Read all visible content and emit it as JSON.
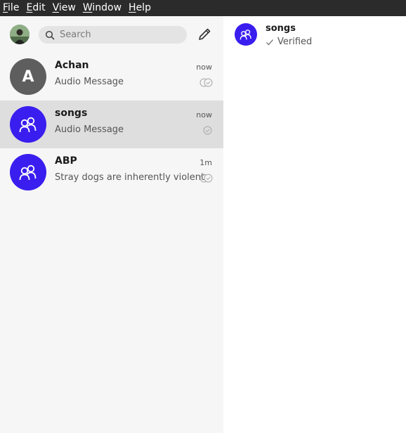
{
  "menubar": {
    "items": [
      {
        "mnemonic": "F",
        "rest": "ile"
      },
      {
        "mnemonic": "E",
        "rest": "dit"
      },
      {
        "mnemonic": "V",
        "rest": "iew"
      },
      {
        "mnemonic": "W",
        "rest": "indow"
      },
      {
        "mnemonic": "H",
        "rest": "elp"
      }
    ]
  },
  "sidebar": {
    "search": {
      "placeholder": "Search"
    },
    "conversations": [
      {
        "avatar_letter": "A",
        "name": "Achan",
        "time": "now",
        "preview": "Audio Message",
        "status": "delivered"
      },
      {
        "name": "songs",
        "time": "now",
        "preview": "Audio Message",
        "status": "sent",
        "selected": true
      },
      {
        "name": "ABP",
        "time": "1m",
        "preview": "Stray dogs are inherently violent",
        "status": "delivered"
      }
    ]
  },
  "conversation_header": {
    "title": "songs",
    "verified_label": "Verified"
  },
  "colors": {
    "menubar_bg": "#2b2b2b",
    "sidebar_bg": "#f6f6f6",
    "selected_bg": "#dedede",
    "group_avatar": "#3a1eef",
    "letter_avatar": "#5e5e5e"
  }
}
